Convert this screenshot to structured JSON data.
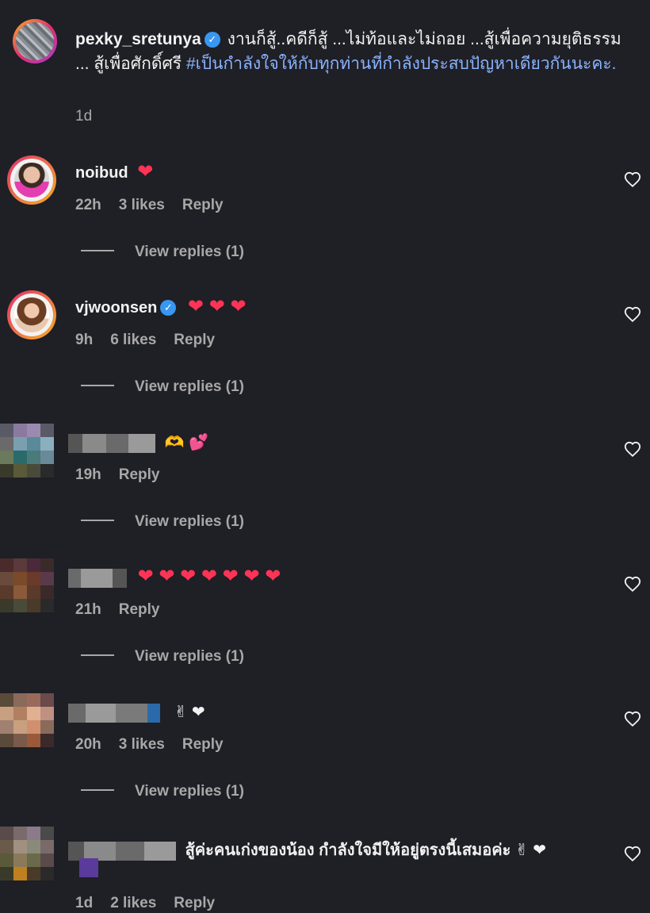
{
  "caption": {
    "username": "pexky_sretunya",
    "verified_mark": "✓",
    "text": "งานก็สู้..คดีก็สู้ ...ไม่ท้อและไม่ถอย ...สู้เพื่อความยุติธรรม ... สู้เพื่อศักดิ์ศรี",
    "hashtag": "#เป็นกำลังใจให้กับทุกท่านที่กำลังประสบปัญหาเดียวกันนะคะ.",
    "time": "1d"
  },
  "comments": [
    {
      "username": "noibud",
      "text": "❤",
      "time": "22h",
      "likes": "3 likes",
      "reply": "Reply",
      "view_replies": "View replies (1)"
    },
    {
      "username": "vjwoonsen",
      "verified_mark": "✓",
      "text": "❤ ❤ ❤",
      "time": "9h",
      "likes": "6 likes",
      "reply": "Reply",
      "view_replies": "View replies (1)"
    },
    {
      "username": "",
      "text": "🫶 💕",
      "time": "19h",
      "likes": "",
      "reply": "Reply",
      "view_replies": "View replies (1)"
    },
    {
      "username": "",
      "text": "❤ ❤ ❤ ❤ ❤ ❤ ❤",
      "time": "21h",
      "likes": "",
      "reply": "Reply",
      "view_replies": "View replies (1)"
    },
    {
      "username": "",
      "text": "✌ ❤",
      "time": "20h",
      "likes": "3 likes",
      "reply": "Reply",
      "view_replies": "View replies (1)"
    },
    {
      "username": "",
      "text": "สู้ค่ะคนเก่งของน้อง กำลังใจมีให้อยู่ตรงนี้เสมอค่ะ ✌ ❤",
      "time": "1d",
      "likes": "2 likes",
      "reply": "Reply"
    }
  ],
  "icons": {
    "like": "heart-outline-icon",
    "verified": "verified-badge-icon"
  },
  "colors": {
    "background": "#1f1f26",
    "heart": "#ff3355",
    "hashtag": "#8ab4ff",
    "meta": "#a8a8a8",
    "verified": "#3897f0"
  }
}
